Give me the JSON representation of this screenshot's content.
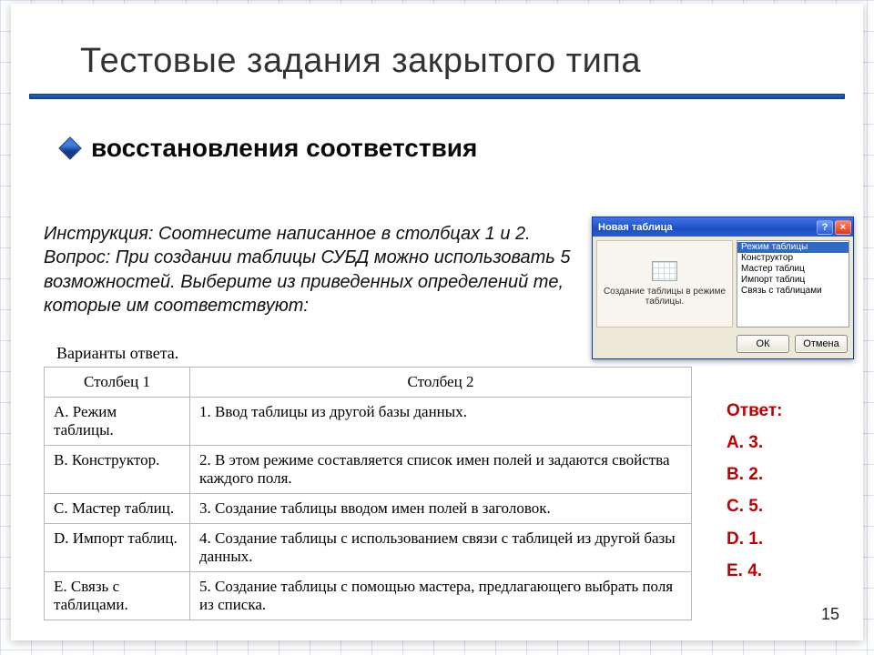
{
  "title": "Тестовые задания закрытого типа",
  "subtitle": "восстановления соответствия",
  "instruction": "Инструкция: Соотнесите написанное в столбцах 1 и 2.",
  "question": "Вопрос: При создании таблицы СУБД можно использовать 5 возможностей. Выберите из приведенных определений те, которые им соответствуют:",
  "answers_caption": "Варианты ответа.",
  "table": {
    "headers": {
      "col1": "Столбец 1",
      "col2": "Столбец 2"
    },
    "rows": [
      {
        "col1": "A. Режим таблицы.",
        "col2": "1. Ввод таблицы из другой базы данных."
      },
      {
        "col1": "B. Конструктор.",
        "col2": "2. В этом режиме составляется список имен полей и задаются свойства каждого поля."
      },
      {
        "col1": "C. Мастер таблиц.",
        "col2": "3. Создание таблицы вводом имен полей в заголовок."
      },
      {
        "col1": "D. Импорт таблиц.",
        "col2": "4. Создание таблицы с использованием связи с таблицей из другой базы данных."
      },
      {
        "col1": "E. Связь с таблицами.",
        "col2": "5. Создание таблицы с помощью мастера, предлагающего выбрать поля из списка."
      }
    ]
  },
  "answer_block": {
    "label": "Ответ:",
    "items": [
      "A. 3.",
      "B. 2.",
      "C. 5.",
      "D. 1.",
      "E. 4."
    ]
  },
  "page_number": "15",
  "dialog": {
    "title": "Новая таблица",
    "help": "?",
    "close": "×",
    "description": "Создание таблицы в режиме таблицы.",
    "options": [
      "Режим таблицы",
      "Конструктор",
      "Мастер таблиц",
      "Импорт таблиц",
      "Связь с таблицами"
    ],
    "ok": "ОК",
    "cancel": "Отмена"
  }
}
